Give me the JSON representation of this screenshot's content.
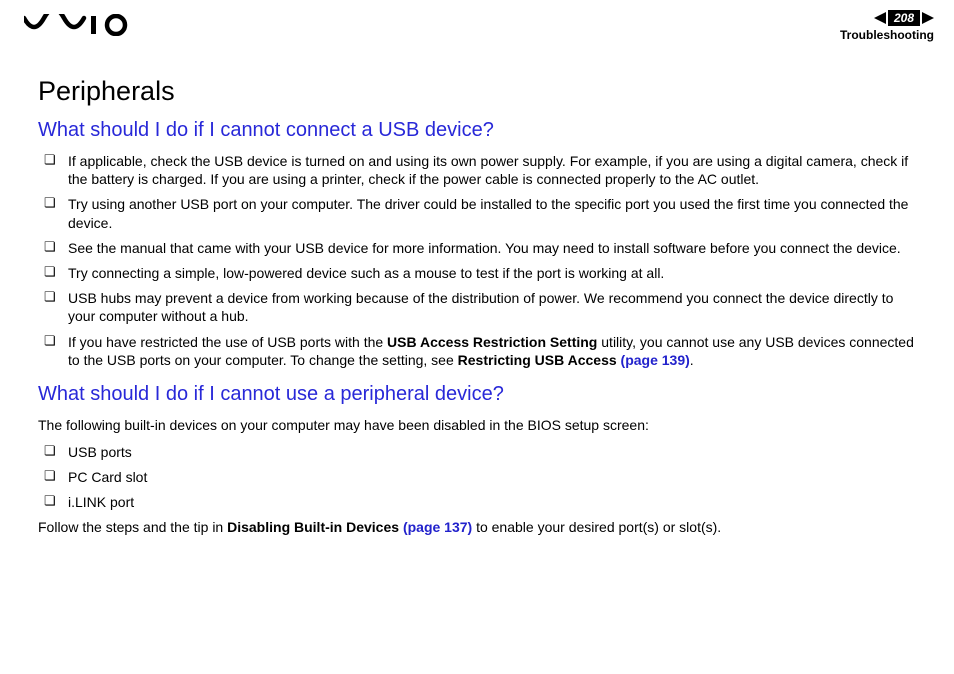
{
  "header": {
    "page_number": "208",
    "section": "Troubleshooting"
  },
  "title": "Peripherals",
  "sec1": {
    "heading": "What should I do if I cannot connect a USB device?",
    "items": [
      "If applicable, check the USB device is turned on and using its own power supply. For example, if you are using a digital camera, check if the battery is charged. If you are using a printer, check if the power cable is connected properly to the AC outlet.",
      "Try using another USB port on your computer. The driver could be installed to the specific port you used the first time you connected the device.",
      "See the manual that came with your USB device for more information. You may need to install software before you connect the device.",
      "Try connecting a simple, low-powered device such as a mouse to test if the port is working at all.",
      "USB hubs may prevent a device from working because of the distribution of power. We recommend you connect the device directly to your computer without a hub."
    ],
    "item6_pre": "If you have restricted the use of USB ports with the ",
    "item6_bold1": "USB Access Restriction Setting",
    "item6_mid": " utility, you cannot use any USB devices connected to the USB ports on your computer. To change the setting, see ",
    "item6_bold2": "Restricting USB Access ",
    "item6_link": "(page 139)",
    "item6_post": "."
  },
  "sec2": {
    "heading": "What should I do if I cannot use a peripheral device?",
    "intro": "The following built-in devices on your computer may have been disabled in the BIOS setup screen:",
    "items": [
      "USB ports",
      "PC Card slot",
      "i.LINK port"
    ],
    "outro_pre": "Follow the steps and the tip in ",
    "outro_bold": "Disabling Built-in Devices ",
    "outro_link": "(page 137)",
    "outro_post": " to enable your desired port(s) or slot(s)."
  }
}
